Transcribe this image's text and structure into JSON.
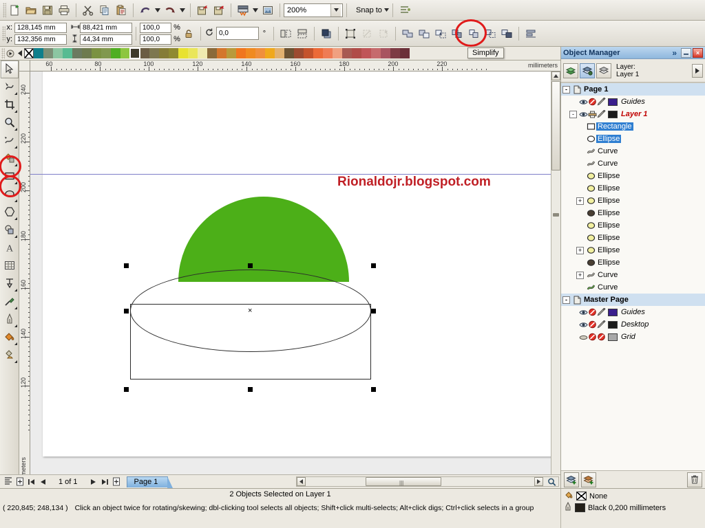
{
  "app": {
    "zoom_level": "200%",
    "snap_label": "Snap to",
    "units": "millimeters"
  },
  "toolbar": {
    "buttons": [
      {
        "name": "new",
        "icon": "new-document-icon"
      },
      {
        "name": "open",
        "icon": "open-folder-icon"
      },
      {
        "name": "save",
        "icon": "save-disk-icon"
      },
      {
        "name": "print",
        "icon": "printer-icon"
      },
      {
        "name": "cut",
        "icon": "scissors-icon"
      },
      {
        "name": "copy",
        "icon": "copy-icon"
      },
      {
        "name": "paste",
        "icon": "paste-icon"
      },
      {
        "name": "undo",
        "icon": "undo-arrow-icon"
      },
      {
        "name": "redo",
        "icon": "redo-arrow-icon"
      },
      {
        "name": "import",
        "icon": "import-icon"
      },
      {
        "name": "export",
        "icon": "export-icon"
      },
      {
        "name": "publish-pdf",
        "icon": "pdf-icon"
      },
      {
        "name": "app-launch",
        "icon": "application-icon"
      }
    ]
  },
  "property_bar": {
    "x_label": "x:",
    "y_label": "y:",
    "x_value": "128,145 mm",
    "y_value": "132,356 mm",
    "width_value": "88,421 mm",
    "height_value": "44,34 mm",
    "scale_h": "100,0",
    "scale_v": "100,0",
    "percent": "%",
    "rotation_value": "0,0",
    "degree": "°",
    "shaping": [
      {
        "name": "weld",
        "label": "Weld"
      },
      {
        "name": "trim",
        "label": "Trim"
      },
      {
        "name": "intersect",
        "label": "Intersect"
      },
      {
        "name": "simplify",
        "label": "Simplify",
        "highlighted": true
      },
      {
        "name": "front-minus-back",
        "label": "Front Minus Back"
      },
      {
        "name": "back-minus-front",
        "label": "Back Minus Front"
      },
      {
        "name": "boundary",
        "label": "Create Boundary"
      }
    ],
    "tooltip": "Simplify"
  },
  "toolbox": {
    "tools": [
      {
        "name": "pick-tool",
        "icon": "arrow-cursor-icon",
        "active": true,
        "flyout": false,
        "ring": false
      },
      {
        "name": "shape-tool",
        "icon": "node-edit-icon",
        "active": false,
        "flyout": true,
        "ring": false
      },
      {
        "name": "crop-tool",
        "icon": "crop-icon",
        "active": false,
        "flyout": true,
        "ring": false
      },
      {
        "name": "zoom-tool",
        "icon": "magnifier-icon",
        "active": false,
        "flyout": true,
        "ring": false
      },
      {
        "name": "freehand-tool",
        "icon": "freehand-curve-icon",
        "active": false,
        "flyout": true,
        "ring": false
      },
      {
        "name": "smart-fill-tool",
        "icon": "smart-fill-icon",
        "active": false,
        "flyout": true,
        "ring": false
      },
      {
        "name": "rectangle-tool",
        "icon": "rectangle-icon",
        "active": false,
        "flyout": true,
        "ring": true
      },
      {
        "name": "ellipse-tool",
        "icon": "ellipse-icon",
        "active": false,
        "flyout": true,
        "ring": true
      },
      {
        "name": "polygon-tool",
        "icon": "polygon-icon",
        "active": false,
        "flyout": true,
        "ring": false
      },
      {
        "name": "basic-shapes-tool",
        "icon": "basic-shapes-icon",
        "active": false,
        "flyout": true,
        "ring": false
      },
      {
        "name": "text-tool",
        "icon": "text-a-icon",
        "active": false,
        "flyout": false,
        "ring": false
      },
      {
        "name": "table-tool",
        "icon": "table-grid-icon",
        "active": false,
        "flyout": false,
        "ring": false
      },
      {
        "name": "dimension-tool",
        "icon": "dimension-icon",
        "active": false,
        "flyout": true,
        "ring": false
      },
      {
        "name": "eyedropper-tool",
        "icon": "eyedropper-icon",
        "active": false,
        "flyout": true,
        "ring": false
      },
      {
        "name": "outline-tool",
        "icon": "pen-nib-icon",
        "active": false,
        "flyout": true,
        "ring": false
      },
      {
        "name": "fill-tool",
        "icon": "paint-bucket-icon",
        "active": false,
        "flyout": true,
        "ring": false
      },
      {
        "name": "interactive-fill",
        "icon": "interactive-fill-icon",
        "active": false,
        "flyout": true,
        "ring": false
      }
    ]
  },
  "palette": {
    "colors": [
      "#ffffff",
      "#0e7f8c",
      "#7b8f76",
      "#8cc6a2",
      "#58bb92",
      "#6b7a60",
      "#6d7a4e",
      "#7b9242",
      "#81984e",
      "#4fae22",
      "#8dc63f",
      "#3e3a2c",
      "#6b5c43",
      "#7d7750",
      "#857c37",
      "#8f8a32",
      "#e8e231",
      "#eae65a",
      "#efeab0",
      "#8a6a3a",
      "#d4762c",
      "#b99a3b",
      "#f0761e",
      "#f08a20",
      "#f08f3c",
      "#f0a81c",
      "#e2b170",
      "#6d5333",
      "#9d4b30",
      "#c4532c",
      "#ec6a38",
      "#ef7c55",
      "#f0a080",
      "#a85a52",
      "#b04c48",
      "#c05558",
      "#c66b6d",
      "#a85460",
      "#7d3b44",
      "#6b3038"
    ],
    "current_index": 11
  },
  "rulers": {
    "h_labels": [
      "60",
      "80",
      "100",
      "120",
      "140",
      "160",
      "180",
      "200",
      "220"
    ],
    "v_labels": [
      "240",
      "220",
      "200",
      "180",
      "160",
      "140",
      "120"
    ],
    "unit_label": "millimeters",
    "corner_unit": "millimeters"
  },
  "canvas": {
    "watermark_text": "Rionaldojr.blogspot.com",
    "watermark_color": "#c02026",
    "green_shape_color": "#4caf18",
    "green_shape_name": "green-semicircle",
    "selection": {
      "name": "selected-objects",
      "handle_count": 8,
      "center_marker": "x"
    }
  },
  "docker": {
    "title": "Object Manager",
    "expand_icon": "chevron-double-right-icon",
    "minimize_icon": "minimize-icon",
    "close_icon": "close-icon",
    "layer_label_line1": "Layer:",
    "layer_label_line2": "Layer 1",
    "view_buttons": [
      {
        "name": "layer-manager-view",
        "icon": "layers-icon",
        "on": false
      },
      {
        "name": "new-object-view",
        "icon": "layer-object-icon",
        "on": true
      },
      {
        "name": "edit-across-layers",
        "icon": "edit-layers-icon",
        "on": false
      }
    ],
    "options_icon": "options-arrow-icon",
    "tree": [
      {
        "name": "page-1",
        "label": "Page 1",
        "kind": "page",
        "indent": 0,
        "expander": "-",
        "style": "page"
      },
      {
        "name": "guides-layer",
        "label": "Guides",
        "kind": "layer",
        "indent": 1,
        "expander": "",
        "style": "italic",
        "color": "#3a1f8c",
        "icons": [
          "eye",
          "disabled",
          "pen"
        ]
      },
      {
        "name": "layer-1",
        "label": "Layer 1",
        "kind": "layer",
        "indent": 1,
        "expander": "-",
        "style": "layer",
        "color": "#1b1b1b",
        "icons": [
          "eye",
          "print",
          "pen"
        ]
      },
      {
        "name": "object-rectangle",
        "label": "Rectangle",
        "kind": "rectangle",
        "indent": 2,
        "expander": "",
        "selected": true
      },
      {
        "name": "object-ellipse-1",
        "label": "Ellipse",
        "kind": "ellipse-outline",
        "indent": 2,
        "expander": "",
        "selected": true
      },
      {
        "name": "object-curve-1",
        "label": "Curve",
        "kind": "curve",
        "indent": 2,
        "expander": ""
      },
      {
        "name": "object-curve-2",
        "label": "Curve",
        "kind": "curve",
        "indent": 2,
        "expander": ""
      },
      {
        "name": "object-ellipse-2",
        "label": "Ellipse",
        "kind": "ellipse-yellow",
        "indent": 2,
        "expander": ""
      },
      {
        "name": "object-ellipse-3",
        "label": "Ellipse",
        "kind": "ellipse-yellow",
        "indent": 2,
        "expander": ""
      },
      {
        "name": "object-ellipse-4",
        "label": "Ellipse",
        "kind": "ellipse-yellow",
        "indent": 2,
        "expander": "+"
      },
      {
        "name": "object-ellipse-5",
        "label": "Ellipse",
        "kind": "ellipse-dark",
        "indent": 2,
        "expander": ""
      },
      {
        "name": "object-ellipse-6",
        "label": "Ellipse",
        "kind": "ellipse-yellow",
        "indent": 2,
        "expander": ""
      },
      {
        "name": "object-ellipse-7",
        "label": "Ellipse",
        "kind": "ellipse-yellow",
        "indent": 2,
        "expander": ""
      },
      {
        "name": "object-ellipse-8",
        "label": "Ellipse",
        "kind": "ellipse-yellow",
        "indent": 2,
        "expander": "+"
      },
      {
        "name": "object-ellipse-9",
        "label": "Ellipse",
        "kind": "ellipse-dark",
        "indent": 2,
        "expander": ""
      },
      {
        "name": "object-curve-3",
        "label": "Curve",
        "kind": "curve",
        "indent": 2,
        "expander": "+"
      },
      {
        "name": "object-curve-4",
        "label": "Curve",
        "kind": "curve-green",
        "indent": 2,
        "expander": ""
      },
      {
        "name": "master-page",
        "label": "Master Page",
        "kind": "page",
        "indent": 0,
        "expander": "-",
        "style": "page"
      },
      {
        "name": "master-guides",
        "label": "Guides",
        "kind": "layer",
        "indent": 1,
        "expander": "",
        "style": "italic",
        "color": "#3a1f8c",
        "icons": [
          "eye",
          "disabled",
          "pen"
        ]
      },
      {
        "name": "master-desktop",
        "label": "Desktop",
        "kind": "layer",
        "indent": 1,
        "expander": "",
        "style": "italic",
        "color": "#1b1b1b",
        "icons": [
          "eye",
          "disabled",
          "pen"
        ]
      },
      {
        "name": "master-grid",
        "label": "Grid",
        "kind": "layer",
        "indent": 1,
        "expander": "",
        "style": "italic",
        "color": "#a8a8a8",
        "icons": [
          "grideye",
          "disabled",
          "disabled"
        ]
      }
    ],
    "bottom_buttons": [
      {
        "name": "new-layer-button",
        "icon": "new-layer-icon"
      },
      {
        "name": "new-master-layer-button",
        "icon": "new-master-layer-icon"
      },
      {
        "name": "delete-button",
        "icon": "trash-icon"
      }
    ]
  },
  "page_nav": {
    "page_counter": "1 of 1",
    "tab_label": "Page 1",
    "first_icon": "first-page-icon",
    "prev_icon": "previous-page-icon",
    "next_icon": "next-page-icon",
    "last_icon": "last-page-icon",
    "add_before_icon": "add-page-before-icon",
    "add_after_icon": "add-page-after-icon"
  },
  "status": {
    "selection_text": "2 Objects Selected on Layer 1",
    "coordinates": "( 220,845; 248,134 )",
    "hint": "Click an object twice for rotating/skewing; dbl-clicking tool selects all objects; Shift+click multi-selects; Alt+click digs; Ctrl+click selects in a group",
    "fill_label": "None",
    "outline_label": "Black  0,200 millimeters",
    "fill_icon": "fill-bucket-icon",
    "outline_icon": "outline-pen-icon"
  }
}
